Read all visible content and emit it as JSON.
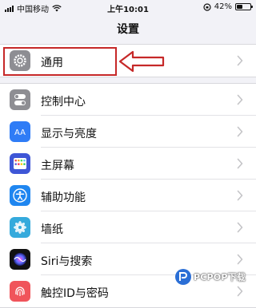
{
  "status_bar": {
    "carrier": "中国移动",
    "time": "上午10:01",
    "battery_percent": "42%",
    "battery_level": 0.42
  },
  "page_title": "设置",
  "groups": [
    {
      "items": [
        {
          "label": "通用",
          "icon": "gear-icon",
          "icon_color": "#8e8e93"
        }
      ]
    },
    {
      "items": [
        {
          "label": "控制中心",
          "icon": "toggle-icon",
          "icon_color": "#8e8e93"
        },
        {
          "label": "显示与亮度",
          "icon": "aa-icon",
          "icon_color": "#2f7cf6",
          "icon_text": "AA"
        },
        {
          "label": "主屏幕",
          "icon": "grid-icon",
          "icon_color": "#3e56d6"
        },
        {
          "label": "辅助功能",
          "icon": "accessibility-icon",
          "icon_color": "#1f86f0"
        },
        {
          "label": "墙纸",
          "icon": "flower-icon",
          "icon_color": "#35aadc"
        },
        {
          "label": "Siri与搜索",
          "icon": "siri-icon",
          "icon_color": "#111111"
        },
        {
          "label": "触控ID与密码",
          "icon": "fingerprint-icon",
          "icon_color": "#f0545b"
        }
      ]
    }
  ],
  "annotation": {
    "highlight_color": "#c62828"
  },
  "watermark": {
    "text": "PCPOP下载"
  }
}
